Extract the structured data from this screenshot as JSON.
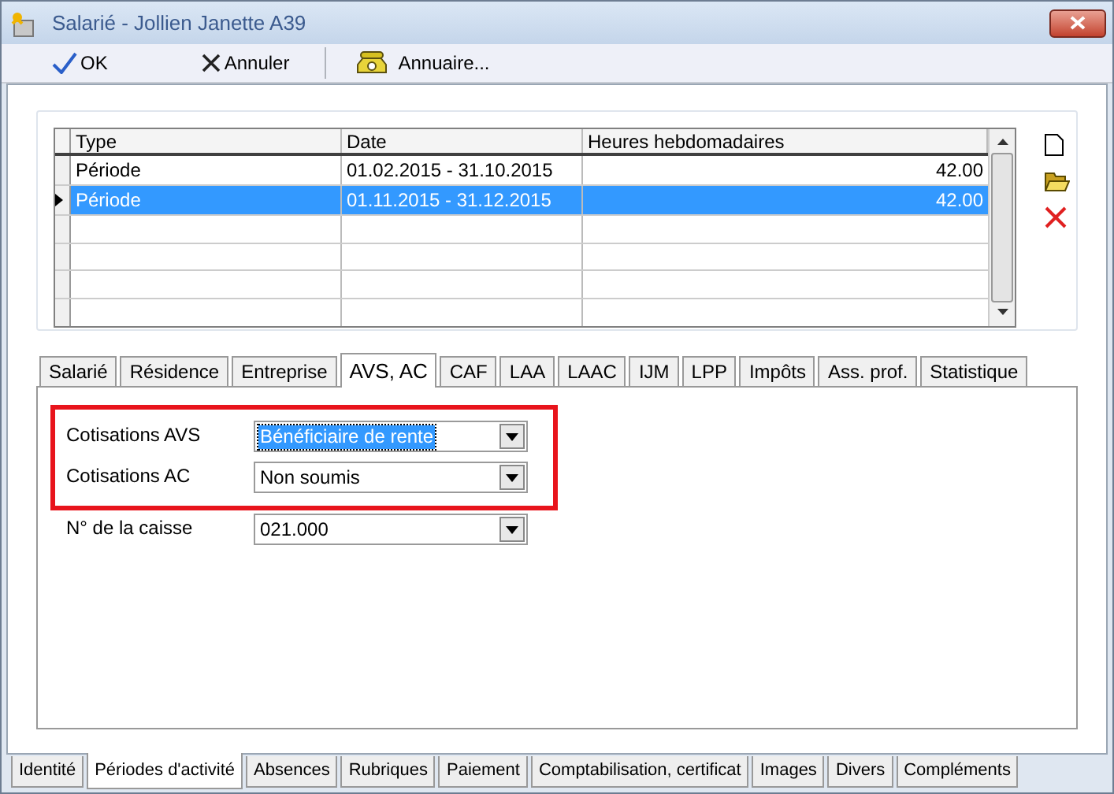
{
  "window": {
    "title": "Salarié - Jollien Janette A39"
  },
  "toolbar": [
    {
      "kind": "ok",
      "label": "OK"
    },
    {
      "kind": "cancel",
      "label": "Annuler"
    },
    {
      "kind": "directory",
      "label": "Annuaire..."
    }
  ],
  "table": {
    "columns": [
      "Type",
      "Date",
      "Heures hebdomadaires"
    ],
    "rows": [
      {
        "type": "Période",
        "date": "01.02.2015 - 31.10.2015",
        "hours": "42.00",
        "selected": false
      },
      {
        "type": "Période",
        "date": "01.11.2015 - 31.12.2015",
        "hours": "42.00",
        "selected": true
      }
    ]
  },
  "tabs": [
    {
      "label": "Salarié",
      "selected": false
    },
    {
      "label": "Résidence",
      "selected": false
    },
    {
      "label": "Entreprise",
      "selected": false
    },
    {
      "label": "AVS, AC",
      "selected": true
    },
    {
      "label": "CAF",
      "selected": false
    },
    {
      "label": "LAA",
      "selected": false
    },
    {
      "label": "LAAC",
      "selected": false
    },
    {
      "label": "IJM",
      "selected": false
    },
    {
      "label": "LPP",
      "selected": false
    },
    {
      "label": "Impôts",
      "selected": false
    },
    {
      "label": "Ass. prof.",
      "selected": false
    },
    {
      "label": "Statistique",
      "selected": false
    }
  ],
  "fields": [
    {
      "label": "Cotisations AVS",
      "value": "Bénéficiaire de rente",
      "selected": true,
      "highlighted": true
    },
    {
      "label": "Cotisations AC",
      "value": "Non soumis",
      "selected": false,
      "highlighted": true
    },
    {
      "label": "N° de la caisse",
      "value": "021.000",
      "selected": false,
      "highlighted": false
    }
  ],
  "bottom_tabs": [
    {
      "label": "Identité",
      "selected": false
    },
    {
      "label": "Périodes d'activité",
      "selected": true
    },
    {
      "label": "Absences",
      "selected": false
    },
    {
      "label": "Rubriques",
      "selected": false
    },
    {
      "label": "Paiement",
      "selected": false
    },
    {
      "label": "Comptabilisation, certificat",
      "selected": false
    },
    {
      "label": "Images",
      "selected": false
    },
    {
      "label": "Divers",
      "selected": false
    },
    {
      "label": "Compléments",
      "selected": false
    }
  ]
}
